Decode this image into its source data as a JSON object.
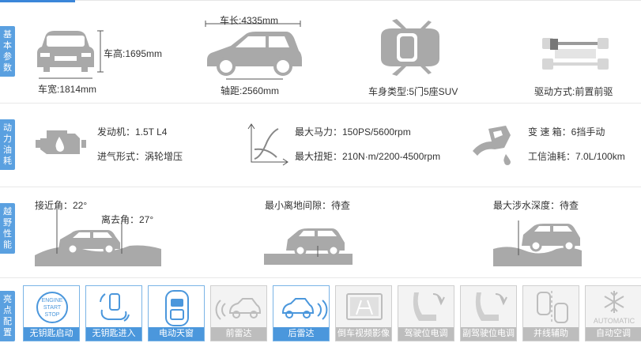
{
  "sections": {
    "basic": {
      "tag": [
        "基",
        "本",
        "参",
        "数"
      ]
    },
    "power": {
      "tag": [
        "动",
        "力",
        "油",
        "耗"
      ]
    },
    "offroad": {
      "tag": [
        "越",
        "野",
        "性",
        "能"
      ]
    },
    "features": {
      "tag": [
        "亮",
        "点",
        "配",
        "置"
      ]
    }
  },
  "basic": {
    "height": "车高:1695mm",
    "width": "车宽:1814mm",
    "length": "车长:4335mm",
    "wheelbase": "轴距:2560mm",
    "body_type": "车身类型:5门5座SUV",
    "drive": "驱动方式:前置前驱"
  },
  "power": {
    "engine": "发动机：1.5T L4",
    "intake": "进气形式：涡轮增压",
    "max_power": "最大马力：150PS/5600rpm",
    "max_torque": "最大扭矩：210N·m/2200-4500rpm",
    "gearbox": "变 速 箱：6挡手动",
    "fuel": "工信油耗：7.0L/100km"
  },
  "offroad": {
    "approach": "接近角：22°",
    "departure": "离去角：27°",
    "clearance": "最小离地间隙：待查",
    "wading": "最大涉水深度：待查"
  },
  "features": [
    {
      "label": "无钥匙启动",
      "on": true,
      "icon": "engine-start-stop-icon",
      "icon_text": [
        "ENGINE",
        "START",
        "STOP"
      ]
    },
    {
      "label": "无钥匙进入",
      "on": true,
      "icon": "keyless-entry-icon"
    },
    {
      "label": "电动天窗",
      "on": true,
      "icon": "sunroof-icon"
    },
    {
      "label": "前雷达",
      "on": false,
      "icon": "front-radar-icon"
    },
    {
      "label": "后雷达",
      "on": true,
      "icon": "rear-radar-icon"
    },
    {
      "label": "倒车视频影像",
      "on": false,
      "icon": "reverse-camera-icon"
    },
    {
      "label": "驾驶位电调",
      "on": false,
      "icon": "driver-seat-icon"
    },
    {
      "label": "副驾驶位电调",
      "on": false,
      "icon": "passenger-seat-icon"
    },
    {
      "label": "并线辅助",
      "on": false,
      "icon": "lane-assist-icon"
    },
    {
      "label": "自动空调",
      "on": false,
      "icon": "auto-ac-icon",
      "icon_text": "AUTOMATIC"
    }
  ]
}
